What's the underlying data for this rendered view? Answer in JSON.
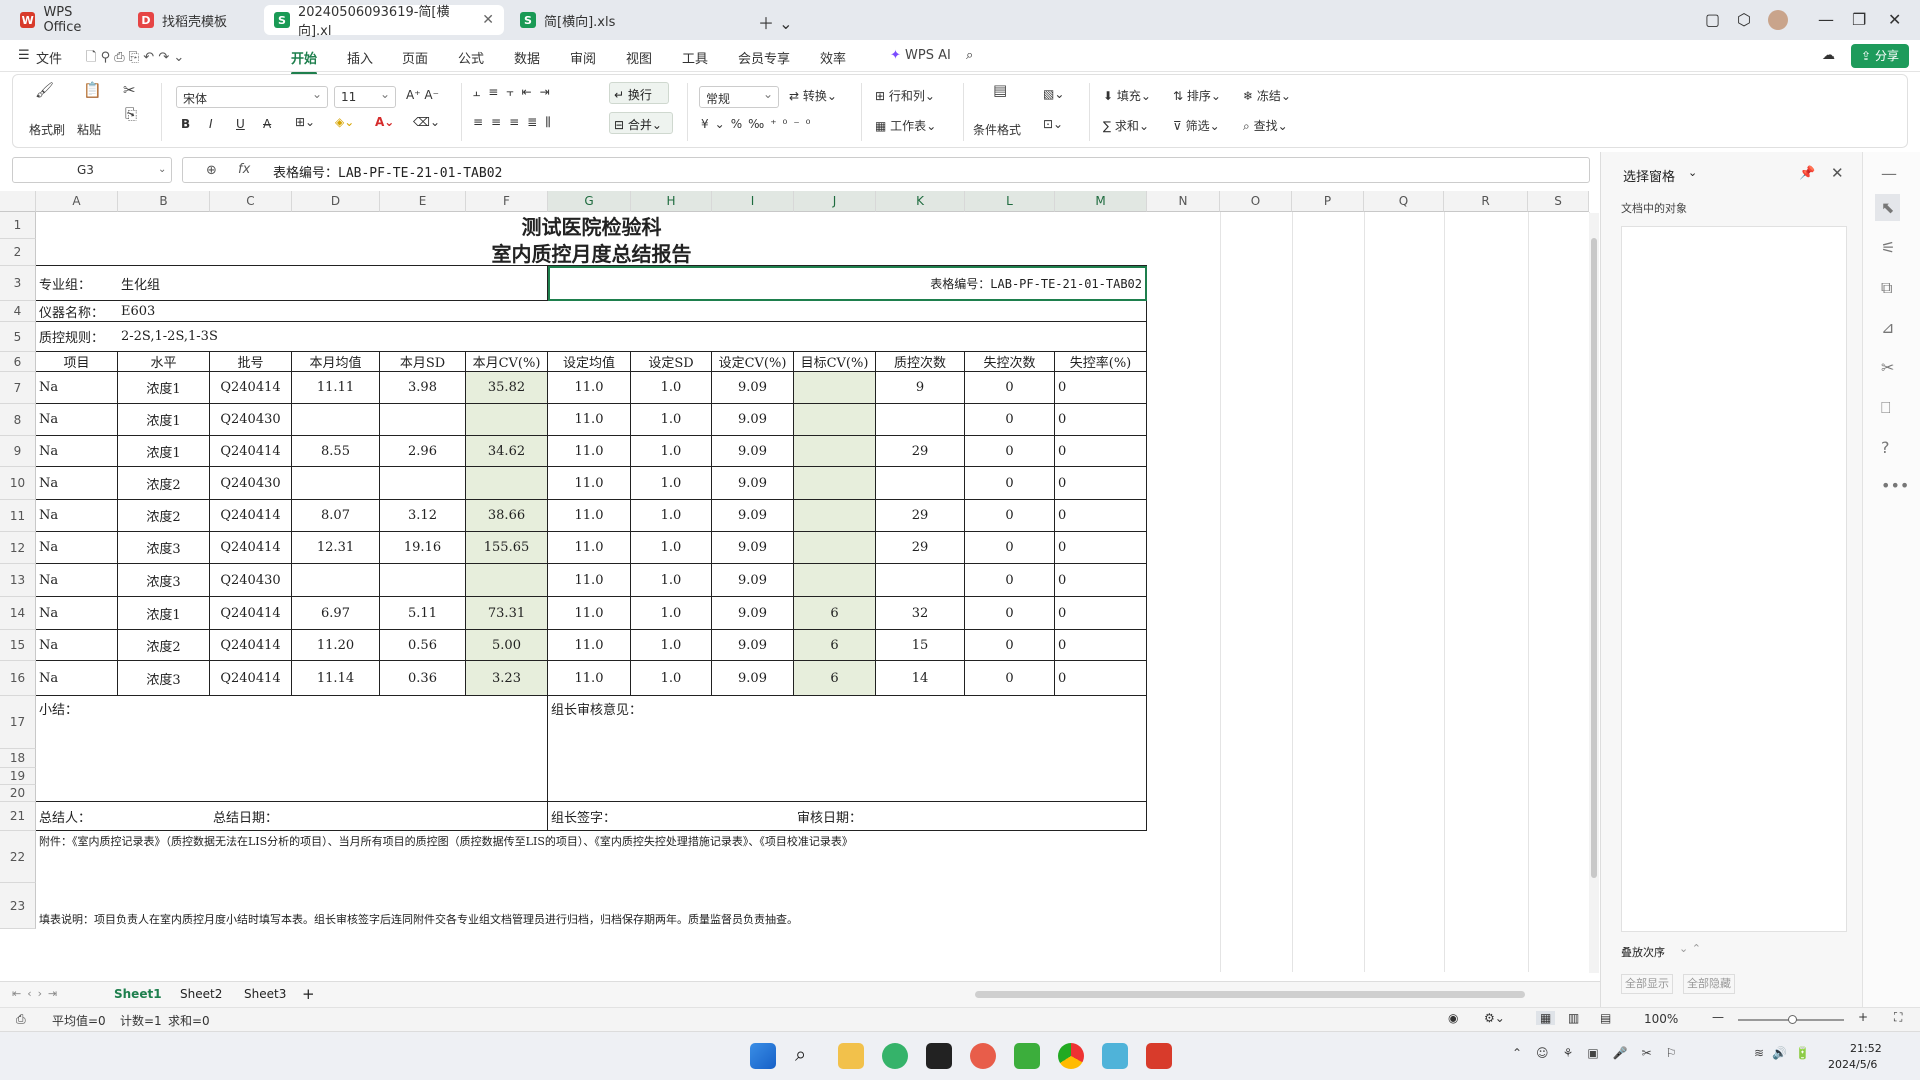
{
  "tabs": [
    {
      "label": "WPS Office",
      "icon": "W",
      "color": "#d83b2b"
    },
    {
      "label": "找稻壳模板",
      "icon": "D",
      "color": "#e64545"
    },
    {
      "label": "20240506093619-简[横向].xl",
      "icon": "S",
      "color": "#1a9a55"
    },
    {
      "label": "简[横向].xls",
      "icon": "S",
      "color": "#1a9a55"
    }
  ],
  "menus": [
    "文件",
    "开始",
    "插入",
    "页面",
    "公式",
    "数据",
    "审阅",
    "视图",
    "工具",
    "会员专享",
    "效率",
    "WPS AI"
  ],
  "share_label": "分享",
  "ribbon": {
    "format_painter": "格式刷",
    "paste": "粘贴",
    "font": "宋体",
    "font_size": "11",
    "wrap": "换行",
    "number_format": "常规",
    "convert": "转换",
    "rows_cols": "行和列",
    "worksheet": "工作表",
    "cond_format": "条件格式",
    "fill": "填充",
    "sort": "排序",
    "freeze": "冻结",
    "sum": "求和",
    "filter": "筛选",
    "find": "查找",
    "merge": "合并"
  },
  "namebox": "G3",
  "formula": "表格编号：LAB-PF-TE-21-01-TAB02",
  "columns": [
    "A",
    "B",
    "C",
    "D",
    "E",
    "F",
    "G",
    "H",
    "I",
    "J",
    "K",
    "L",
    "M",
    "N",
    "O",
    "P",
    "Q",
    "R",
    "S"
  ],
  "rows": [
    "1",
    "2",
    "3",
    "4",
    "5",
    "6",
    "7",
    "8",
    "9",
    "10",
    "11",
    "12",
    "13",
    "14",
    "15",
    "16",
    "17",
    "18",
    "19",
    "20",
    "21",
    "22",
    "23"
  ],
  "report": {
    "title1": "测试医院检验科",
    "title2": "室内质控月度总结报告",
    "group_label": "专业组：",
    "group_value": "生化组",
    "form_no": "表格编号：LAB-PF-TE-21-01-TAB02",
    "instrument_label": "仪器名称：",
    "instrument_value": "E603",
    "rule_label": "质控规则：",
    "rule_value": "2-2S,1-2S,1-3S",
    "headers": [
      "项目",
      "水平",
      "批号",
      "本月均值",
      "本月SD",
      "本月CV(%)",
      "设定均值",
      "设定SD",
      "设定CV(%)",
      "目标CV(%)",
      "质控次数",
      "失控次数",
      "失控率(%)"
    ],
    "data": [
      [
        "Na",
        "浓度1",
        "Q240414",
        "11.11",
        "3.98",
        "35.82",
        "11.0",
        "1.0",
        "9.09",
        "",
        "9",
        "0",
        "0"
      ],
      [
        "Na",
        "浓度1",
        "Q240430",
        "",
        "",
        "",
        "11.0",
        "1.0",
        "9.09",
        "",
        "",
        "0",
        "0"
      ],
      [
        "Na",
        "浓度1",
        "Q240414",
        "8.55",
        "2.96",
        "34.62",
        "11.0",
        "1.0",
        "9.09",
        "",
        "29",
        "0",
        "0"
      ],
      [
        "Na",
        "浓度2",
        "Q240430",
        "",
        "",
        "",
        "11.0",
        "1.0",
        "9.09",
        "",
        "",
        "0",
        "0"
      ],
      [
        "Na",
        "浓度2",
        "Q240414",
        "8.07",
        "3.12",
        "38.66",
        "11.0",
        "1.0",
        "9.09",
        "",
        "29",
        "0",
        "0"
      ],
      [
        "Na",
        "浓度3",
        "Q240414",
        "12.31",
        "19.16",
        "155.65",
        "11.0",
        "1.0",
        "9.09",
        "",
        "29",
        "0",
        "0"
      ],
      [
        "Na",
        "浓度3",
        "Q240430",
        "",
        "",
        "",
        "11.0",
        "1.0",
        "9.09",
        "",
        "",
        "0",
        "0"
      ],
      [
        "Na",
        "浓度1",
        "Q240414",
        "6.97",
        "5.11",
        "73.31",
        "11.0",
        "1.0",
        "9.09",
        "6",
        "32",
        "0",
        "0"
      ],
      [
        "Na",
        "浓度2",
        "Q240414",
        "11.20",
        "0.56",
        "5.00",
        "11.0",
        "1.0",
        "9.09",
        "6",
        "15",
        "0",
        "0"
      ],
      [
        "Na",
        "浓度3",
        "Q240414",
        "11.14",
        "0.36",
        "3.23",
        "11.0",
        "1.0",
        "9.09",
        "6",
        "14",
        "0",
        "0"
      ]
    ],
    "summary_label": "小结：",
    "review_label": "组长审核意见：",
    "summarizer": "总结人：",
    "summary_date": "总结日期：",
    "leader_sign": "组长签字：",
    "review_date": "审核日期：",
    "attachment": "附件：《室内质控记录表》（质控数据无法在LIS分析的项目）、当月所有项目的质控图（质控数据传至LIS的项目）、《室内质控失控处理措施记录表》、《项目校准记录表》",
    "note": "填表说明：项目负责人在室内质控月度小结时填写本表。组长审核签字后连同附件交各专业组文档管理员进行归档，归档保存期两年。质量监督员负责抽查。"
  },
  "sheets": [
    "Sheet1",
    "Sheet2",
    "Sheet3"
  ],
  "status": {
    "avg": "平均值=0",
    "count": "计数=1",
    "sum": "求和=0",
    "zoom": "100%"
  },
  "side_panel": {
    "title": "选择窗格",
    "objects_label": "文档中的对象",
    "order_label": "叠放次序",
    "show_all": "全部显示",
    "hide_all": "全部隐藏"
  },
  "clock": {
    "time": "21:52",
    "date": "2024/5/6"
  }
}
